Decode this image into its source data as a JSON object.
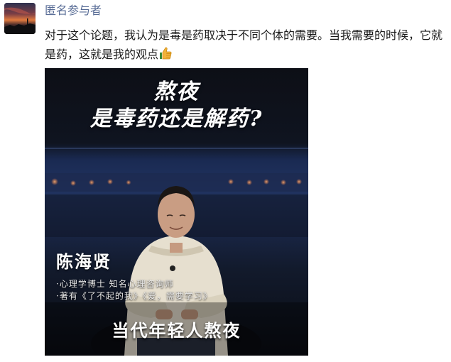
{
  "post": {
    "author": "匿名参与者",
    "text": "对于这个论题，我认为是毒是药取决于不同个体的需要。当我需要的时候，它就是药，这就是我的观点",
    "emoji": "thumbs-up-icon"
  },
  "media": {
    "title_line1": "熬夜",
    "title_line2": "是毒药还是解药?",
    "speaker_name": "陈海贤",
    "speaker_role_1": "·心理学博士  知名心理咨询师",
    "speaker_role_2": "·著有《了不起的我》《爱，需要学习》",
    "caption": "当代年轻人熬夜"
  },
  "colors": {
    "author_link": "#576b95",
    "text": "#1a1a1a",
    "background": "#ffffff"
  }
}
